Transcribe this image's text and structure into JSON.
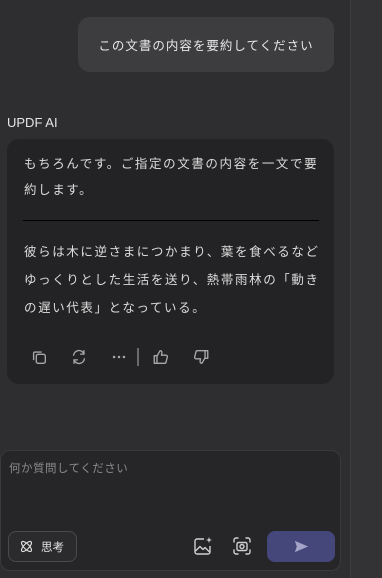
{
  "user_message": "この文書の内容を要約してください",
  "assistant": {
    "label": "UPDF AI",
    "paragraph1": "もちろんです。ご指定の文書の内容を一文で要約します。",
    "paragraph2": "彼らは木に逆さまにつかまり、葉を食べるなどゆっくりとした生活を送り、熱帯雨林の「動きの遅い代表」となっている。",
    "actions": [
      "copy-icon",
      "regenerate-icon",
      "more-icon",
      "thumbs-up-icon",
      "thumbs-down-icon"
    ]
  },
  "composer": {
    "placeholder": "何か質問してください",
    "think_label": "思考",
    "accent_color": "#45467a"
  }
}
